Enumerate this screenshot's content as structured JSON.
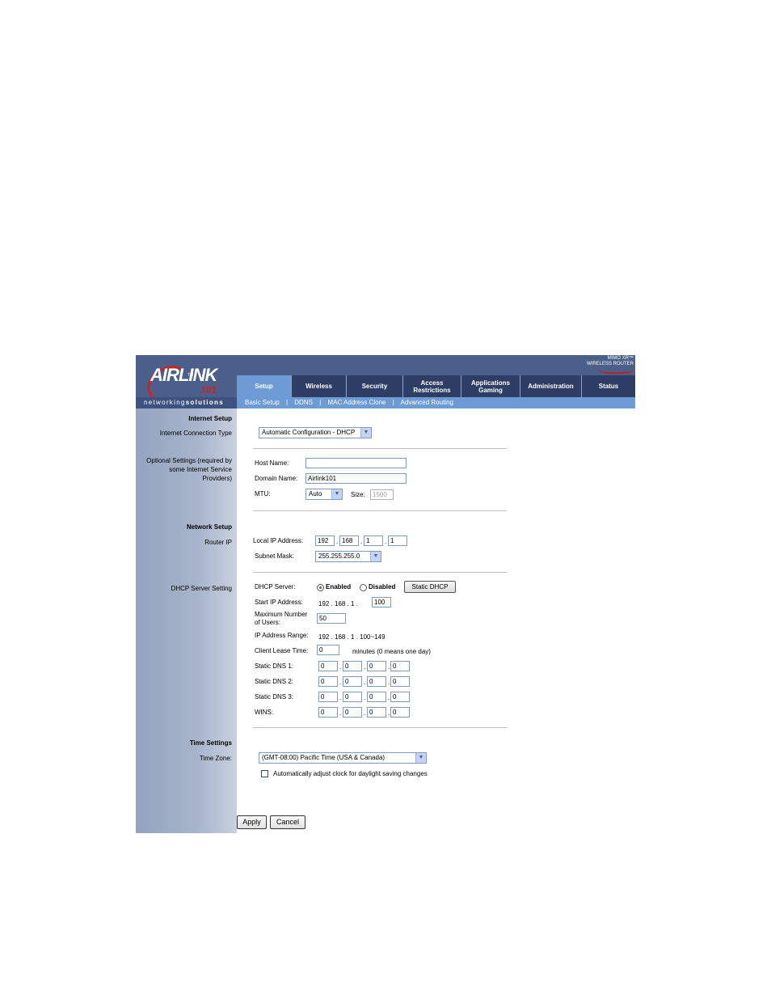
{
  "header": {
    "logo_text_main": "AIRLINK",
    "logo_text_number": "101",
    "logo_tm": "TM",
    "brand_prefix": "networking",
    "brand_suffix": "solutions",
    "product_line1": "MIMO XR™",
    "product_line2": "WIRELESS ROUTER"
  },
  "tabs": [
    {
      "label": "Setup"
    },
    {
      "label": "Wireless"
    },
    {
      "label": "Security"
    },
    {
      "label": "Access Restrictions"
    },
    {
      "label": "Applications Gaming"
    },
    {
      "label": "Administration"
    },
    {
      "label": "Status"
    }
  ],
  "subnav": {
    "items": [
      "Basic Setup",
      "DDNS",
      "MAC Address Clone",
      "Advanced Routing"
    ],
    "separator": "|"
  },
  "sidebar": {
    "internet_setup": "Internet Setup",
    "connection_type": "Internet Connection Type",
    "optional_settings": "Optional Settings (required by some Internet Service Providers)",
    "network_setup": "Network Setup",
    "router_ip": "Router IP",
    "dhcp_server_setting": "DHCP Server Setting",
    "time_settings": "Time Settings",
    "time_zone": "Time Zone:"
  },
  "internet": {
    "connection_type_value": "Automatic Configuration - DHCP",
    "host_name_label": "Host Name:",
    "host_name_value": "",
    "domain_name_label": "Domain Name:",
    "domain_name_value": "Airlink101",
    "mtu_label": "MTU:",
    "mtu_value": "Auto",
    "size_label": "Size:",
    "size_value": "1500"
  },
  "network": {
    "local_ip_label": "Local IP Address:",
    "local_ip": [
      "192",
      "168",
      "1",
      "1"
    ],
    "subnet_label": "Subnet Mask:",
    "subnet_value": "255.255.255.0"
  },
  "dhcp": {
    "server_label": "DHCP Server:",
    "enabled_label": "Enabled",
    "disabled_label": "Disabled",
    "selected": "Enabled",
    "static_dhcp_button": "Static DHCP",
    "start_ip_label": "Start IP Address:",
    "start_ip_prefix": "192 . 168 . 1 .",
    "start_ip_last": "100",
    "max_users_label": "Maximum Number of Users:",
    "max_users_value": "50",
    "ip_range_label": "IP Address Range:",
    "ip_range_value": "192 . 168 . 1 . 100~149",
    "lease_label": "Client Lease Time:",
    "lease_value": "0",
    "lease_hint": "minutes (0 means one day)",
    "dns1_label": "Static DNS 1:",
    "dns1": [
      "0",
      "0",
      "0",
      "0"
    ],
    "dns2_label": "Static DNS 2:",
    "dns2": [
      "0",
      "0",
      "0",
      "0"
    ],
    "dns3_label": "Static DNS 3:",
    "dns3": [
      "0",
      "0",
      "0",
      "0"
    ],
    "wins_label": "WINS:",
    "wins": [
      "0",
      "0",
      "0",
      "0"
    ]
  },
  "time": {
    "zone_value": "(GMT-08:00) Pacific Time (USA & Canada)",
    "dst_label": "Automatically adjust clock for daylight saving changes",
    "dst_checked": false
  },
  "actions": {
    "apply": "Apply",
    "cancel": "Cancel"
  },
  "colors": {
    "header_bg": "#4a5f8a",
    "tab_active": "#6e9ad6",
    "tab_inactive": "#2d3d63",
    "sidebar": "#a7b4cb",
    "logo_red": "#d02020"
  }
}
